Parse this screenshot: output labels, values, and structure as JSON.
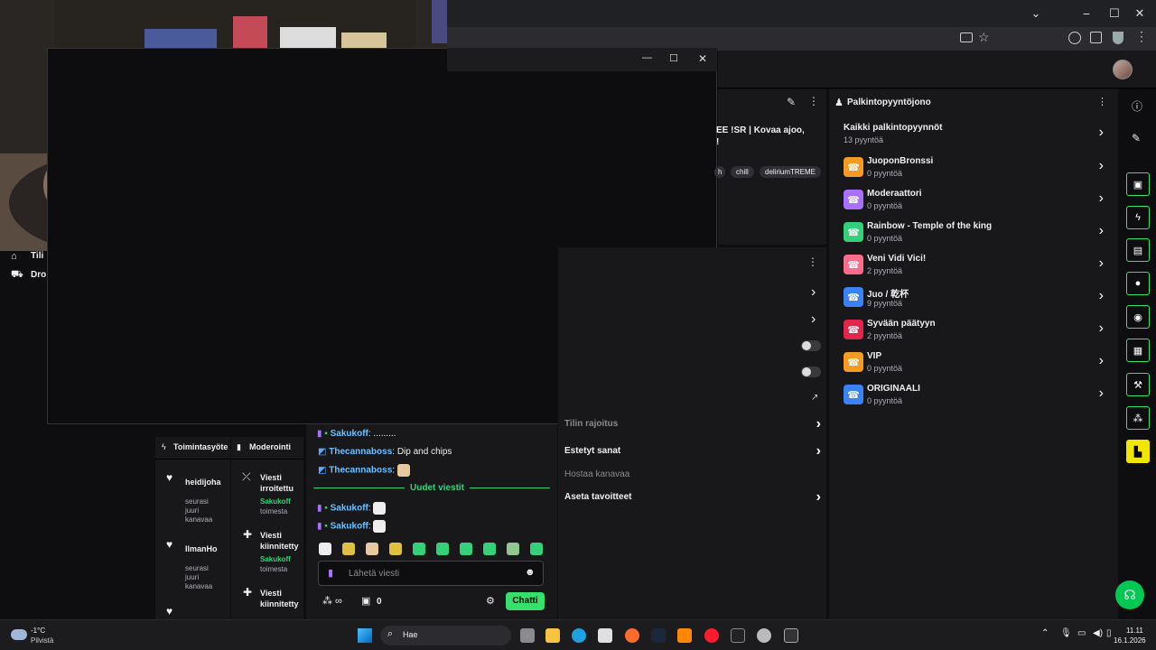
{
  "browser": {
    "minimize": "⎯",
    "maximize": "☐",
    "close": "✕",
    "dropdown": "⌄"
  },
  "dark_window": {
    "minimize": "—",
    "maximize": "☐",
    "close": "✕"
  },
  "stream_info": {
    "title_fragment_1": "EE !SR | Kovaa ajoo,",
    "title_fragment_2": "!",
    "tag_1": "h",
    "tag_2": "chill",
    "tag_3": "deliriumTREME"
  },
  "rewards": {
    "header": "Palkintopyyntöjono",
    "all_label": "Kaikki palkintopyynnöt",
    "all_count": "13 pyyntöä",
    "items": [
      {
        "name": "JuoponBronssi",
        "count": "0 pyyntöä",
        "color": "#f59a23"
      },
      {
        "name": "Moderaattori",
        "count": "0 pyyntöä",
        "color": "#a970ff"
      },
      {
        "name": "Rainbow - Temple of the king",
        "count": "0 pyyntöä",
        "color": "#35d17a"
      },
      {
        "name": "Veni Vidi Vici!",
        "count": "2 pyyntöä",
        "color": "#ff6b8a"
      },
      {
        "name": "Juo / 乾杯",
        "count": "9 pyyntöä",
        "color": "#3b82f6"
      },
      {
        "name": "Syvään päätyyn",
        "count": "2 pyyntöä",
        "color": "#e0264a"
      },
      {
        "name": "VIP",
        "count": "0 pyyntöä",
        "color": "#f59a23"
      },
      {
        "name": "ORIGINAALI",
        "count": "0 pyyntöä",
        "color": "#3b82f6"
      }
    ]
  },
  "settings": {
    "row_partial": "Tilin rajoitus",
    "blocked_words": "Estetyt sanat",
    "host_channel": "Hostaa kanavaa",
    "set_goals": "Aseta tavoitteet"
  },
  "left_sidebar": {
    "item_1": "Tili",
    "item_2": "Dro"
  },
  "activity": {
    "tab": "Toimintasyöte",
    "items": [
      {
        "user": "heidijoha",
        "desc": "seurasi juuri kanavaa"
      },
      {
        "user": "IlmanHo",
        "desc": "seurasi juuri kanavaa"
      }
    ]
  },
  "moderation": {
    "tab": "Moderointi",
    "items": [
      {
        "title": "Viesti irroitettu",
        "by": "Sakukoff",
        "action": "toimesta"
      },
      {
        "title": "Viesti kiinnitetty",
        "by": "Sakukoff",
        "action": "toimesta"
      },
      {
        "title": "Viesti kiinnitetty",
        "by": "",
        "action": ""
      }
    ]
  },
  "chat": {
    "msgs": [
      {
        "user": "Sakukoff",
        "text": ": ........."
      },
      {
        "user": "Thecannaboss",
        "text": ": Dip and chips"
      },
      {
        "user": "Thecannaboss",
        "text": ":"
      }
    ],
    "new_messages": "Uudet viestit",
    "new_msgs": [
      {
        "user": "Sakukoff",
        "text": ":"
      },
      {
        "user": "Sakukoff",
        "text": ":"
      }
    ],
    "input_placeholder": "Lähetä viesti",
    "points": "0",
    "chat_button": "Chatti"
  },
  "taskbar": {
    "weather_temp": "-1°C",
    "weather_desc": "Pilvistä",
    "search_label": "Hae",
    "time": "11.11",
    "date": "16.1.2026"
  }
}
